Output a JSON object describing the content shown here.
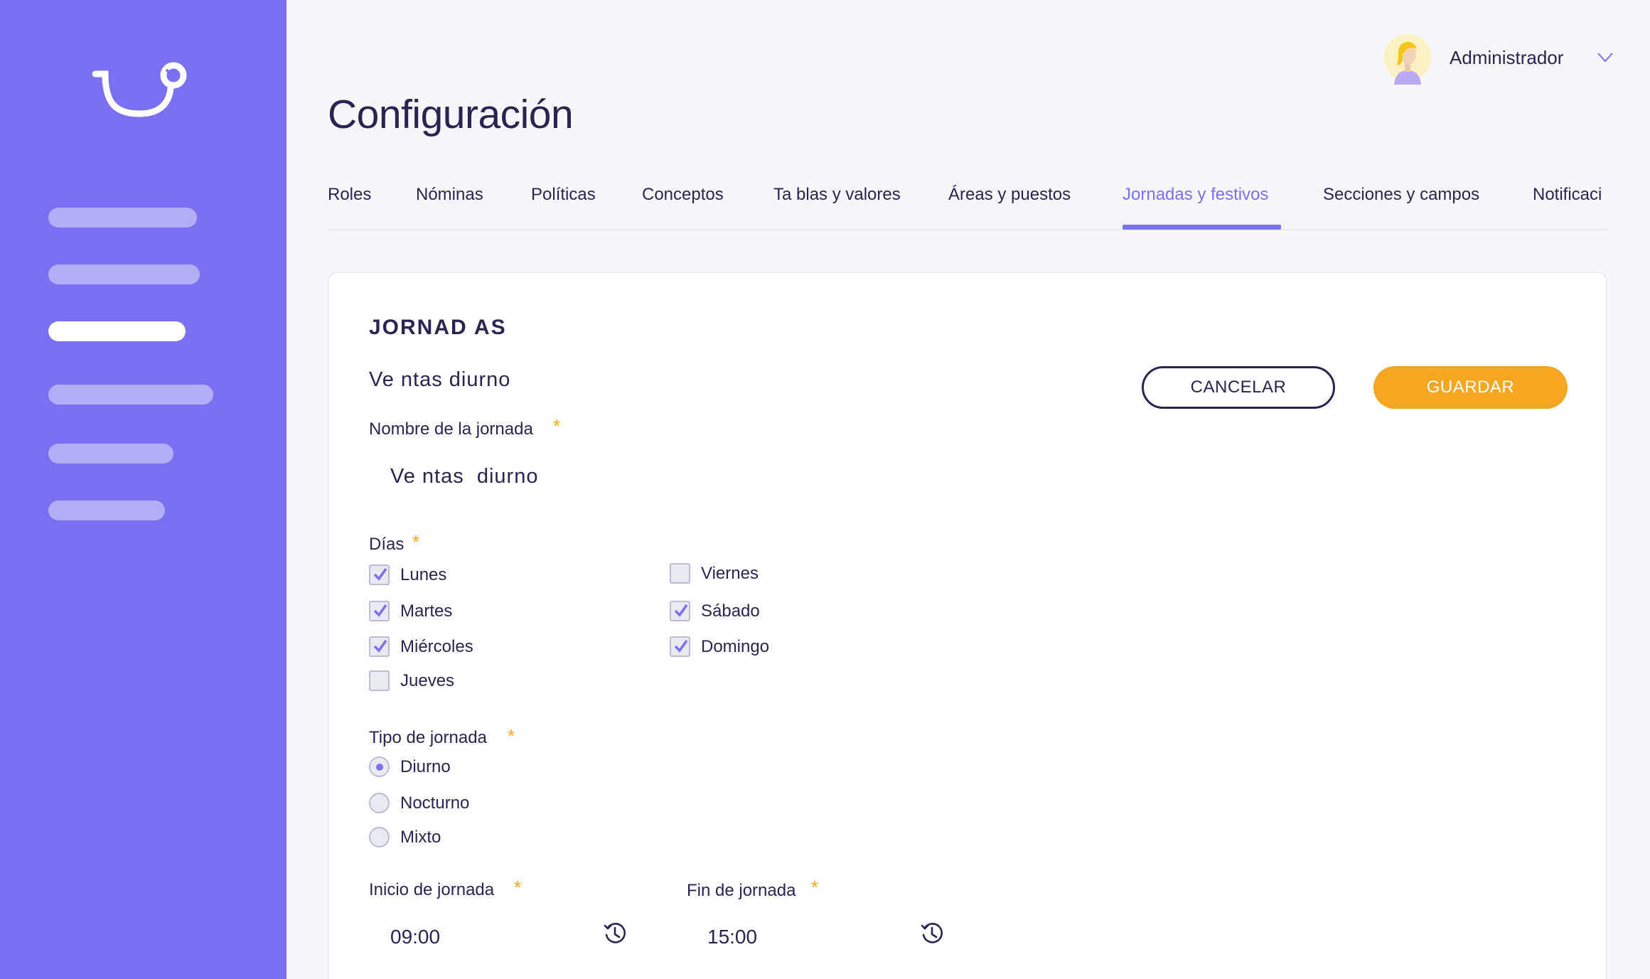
{
  "page": {
    "title": "Configuración"
  },
  "user": {
    "name": "Administrador",
    "avatar_icon": "avatar-icon"
  },
  "sidebar": {
    "items": [
      {
        "state": "inactive"
      },
      {
        "state": "inactive"
      },
      {
        "state": "active"
      },
      {
        "state": "inactive"
      },
      {
        "state": "inactive"
      },
      {
        "state": "inactive"
      }
    ]
  },
  "tabs": [
    {
      "label": "Roles"
    },
    {
      "label": "Nóminas"
    },
    {
      "label": "Políticas"
    },
    {
      "label": "Conceptos"
    },
    {
      "label": "Ta blas  y  valores"
    },
    {
      "label": "Áreas y puestos"
    },
    {
      "label": "Jornadas y festivos",
      "active": true
    },
    {
      "label": "Secciones y campos"
    },
    {
      "label": "Notificaci"
    }
  ],
  "form": {
    "section_title": "JORNAD  AS",
    "subtitle": "Ve ntas  diurno",
    "cancel_label": "CANCELAR",
    "save_label": "GUARDAR",
    "required_mark": "*",
    "name_label": "Nombre de la jornada",
    "name_value": "Ve ntas  diurno",
    "days_label": "Días",
    "days": [
      {
        "label": "Lunes",
        "checked": true
      },
      {
        "label": "Martes",
        "checked": true
      },
      {
        "label": "Miércoles",
        "checked": true
      },
      {
        "label": "Jueves",
        "checked": false
      },
      {
        "label": "Viernes",
        "checked": false
      },
      {
        "label": "Sábado",
        "checked": true
      },
      {
        "label": "Domingo",
        "checked": true
      }
    ],
    "type_label": "Tipo de jornada",
    "types": [
      {
        "label": "Diurno",
        "selected": true
      },
      {
        "label": "Nocturno",
        "selected": false
      },
      {
        "label": "Mixto",
        "selected": false
      }
    ],
    "start_label": "Inicio de jornada",
    "start_value": "09:00",
    "end_label": "Fin de jornada",
    "end_value": "15:00"
  },
  "colors": {
    "accent": "#7b6ff2",
    "primary_button": "#f5a623",
    "text": "#2a2550"
  }
}
